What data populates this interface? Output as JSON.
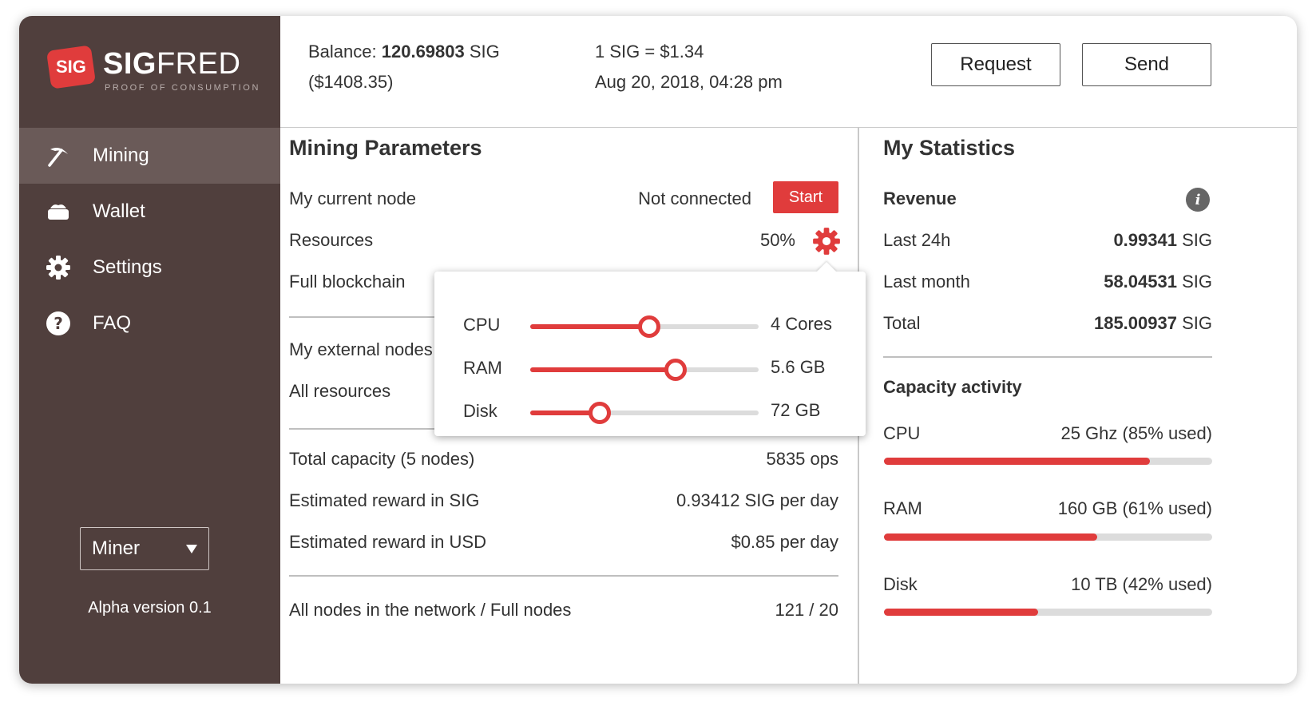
{
  "app": {
    "logo_badge": "SIG",
    "logo_bold": "SIG",
    "logo_thin": "FRED",
    "tagline": "PROOF OF CONSUMPTION"
  },
  "colors": {
    "accent": "#e03c3c",
    "sidebar": "#503f3d",
    "sidebar_active": "#6a5a58"
  },
  "sidebar": {
    "items": [
      {
        "label": "Mining",
        "icon": "pickaxe-icon",
        "active": true
      },
      {
        "label": "Wallet",
        "icon": "wallet-icon",
        "active": false
      },
      {
        "label": "Settings",
        "icon": "gear-icon",
        "active": false
      },
      {
        "label": "FAQ",
        "icon": "question-icon",
        "active": false
      }
    ],
    "role": "Miner",
    "version": "Alpha version 0.1"
  },
  "header": {
    "balance_label": "Balance:",
    "balance_value": "120.69803",
    "balance_unit": "SIG",
    "balance_usd": "($1408.35)",
    "rate": "1 SIG = $1.34",
    "datetime": "Aug 20, 2018, 04:28 pm",
    "request_label": "Request",
    "send_label": "Send"
  },
  "mining": {
    "title": "Mining Parameters",
    "current_node_label": "My current node",
    "current_node_status": "Not connected",
    "start_label": "Start",
    "resources_label": "Resources",
    "resources_value": "50%",
    "full_blockchain_label": "Full blockchain",
    "external_nodes_label": "My external nodes",
    "all_resources_label": "All resources",
    "total_capacity_label": "Total capacity (5 nodes)",
    "total_capacity_value": "5835 ops",
    "reward_sig_label": "Estimated reward in SIG",
    "reward_sig_value": "0.93412 SIG per day",
    "reward_usd_label": "Estimated reward in USD",
    "reward_usd_value": "$0.85 per day",
    "network_label": "All nodes in the network / Full nodes",
    "network_value": "121 / 20"
  },
  "resources_popup": {
    "sliders": [
      {
        "label": "CPU",
        "value": "4 Cores",
        "fraction": 0.52
      },
      {
        "label": "RAM",
        "value": "5.6 GB",
        "fraction": 0.635
      },
      {
        "label": "Disk",
        "value": "72 GB",
        "fraction": 0.305
      }
    ]
  },
  "stats": {
    "title": "My Statistics",
    "revenue_label": "Revenue",
    "rows": [
      {
        "label": "Last 24h",
        "value": "0.99341",
        "unit": "SIG"
      },
      {
        "label": "Last month",
        "value": "58.04531",
        "unit": "SIG"
      },
      {
        "label": "Total",
        "value": "185.00937",
        "unit": "SIG"
      }
    ],
    "capacity_title": "Capacity activity",
    "capacity": [
      {
        "label": "CPU",
        "value": "25 Ghz (85% used)",
        "fraction": 0.81
      },
      {
        "label": "RAM",
        "value": "160 GB (61% used)",
        "fraction": 0.65
      },
      {
        "label": "Disk",
        "value": "10 TB (42% used)",
        "fraction": 0.47
      }
    ]
  }
}
